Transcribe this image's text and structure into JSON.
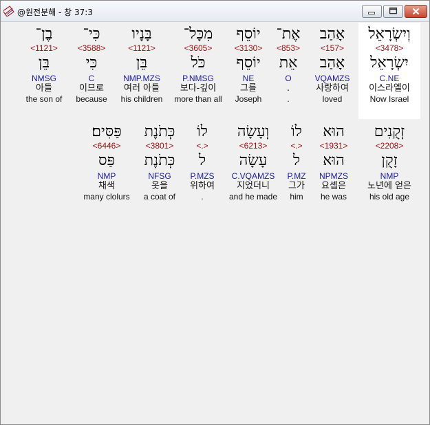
{
  "window": {
    "title": "@원전분해 - 창 37:3",
    "icon": "app-book-icon",
    "minimize_icon": "minimize-icon",
    "maximize_icon": "maximize-icon",
    "close_icon": "close-icon"
  },
  "colors": {
    "strong_number": "#a01010",
    "parsing": "#1a1aa8",
    "highlight": "#ffffff"
  },
  "verse": {
    "rows": [
      {
        "words": [
          {
            "hebrew": "וְיִשְׂרָאֵל",
            "strong": "<3478>",
            "lemma": "יִשְׂרָאֵל",
            "parsing": "C.NE",
            "korean": "이스라엘이",
            "english": "Now Israel",
            "selected": true
          },
          {
            "hebrew": "אָהַב",
            "strong": "<157>",
            "lemma": "אָהַב",
            "parsing": "VQAMZS",
            "korean": "사랑하여",
            "english": "loved"
          },
          {
            "hebrew": "אֶת־",
            "strong": "<853>",
            "lemma": "אֵת",
            "parsing": "O",
            "korean": ".",
            "english": "."
          },
          {
            "hebrew": "יוֹסֵף",
            "strong": "<3130>",
            "lemma": "יוֹסֵף",
            "parsing": "NE",
            "korean": "그를",
            "english": "Joseph"
          },
          {
            "hebrew": "מִכָּל־",
            "strong": "<3605>",
            "lemma": "כֹּל",
            "parsing": "P.NMSG",
            "korean": "보다-깊이",
            "english": "more than all"
          },
          {
            "hebrew": "בָּנָיו",
            "strong": "<1121>",
            "lemma": "בֵּן",
            "parsing": "NMP.MZS",
            "korean": "여러 아들",
            "english": "his children"
          },
          {
            "hebrew": "כִּי־",
            "strong": "<3588>",
            "lemma": "כִּי",
            "parsing": "C",
            "korean": "이므로",
            "english": "because"
          },
          {
            "hebrew": "בֶן־",
            "strong": "<1121>",
            "lemma": "בֵּן",
            "parsing": "NMSG",
            "korean": "아들",
            "english": "the son of"
          }
        ]
      },
      {
        "words": [
          {
            "hebrew": "זְקֻנִים",
            "strong": "<2208>",
            "lemma": "זָקֻן",
            "parsing": "NMP",
            "korean": "노년에 얻은",
            "english": "his old age"
          },
          {
            "hebrew": "הוּא",
            "strong": "<1931>",
            "lemma": "הוּא",
            "parsing": "NPMZS",
            "korean": "요셉은",
            "english": "he was"
          },
          {
            "hebrew": "לוֹ",
            "strong": "<.>",
            "lemma": "ל",
            "parsing": "P.MZ",
            "korean": "그가",
            "english": "him"
          },
          {
            "hebrew": "וְעָשָׂה",
            "strong": "<6213>",
            "lemma": "עָשָׂה",
            "parsing": "C.VQAMZS",
            "korean": "지었더니",
            "english": "and he made"
          },
          {
            "hebrew": "לוֹ",
            "strong": "<.>",
            "lemma": "ל",
            "parsing": "P.MZS",
            "korean": "위하여",
            "english": "."
          },
          {
            "hebrew": "כְּתֹנֶת",
            "strong": "<3801>",
            "lemma": "כְּתֹנֶת",
            "parsing": "NFSG",
            "korean": "옷을",
            "english": "a coat of"
          },
          {
            "hebrew": "פַּסִּים׃",
            "strong": "<6446>",
            "lemma": "פַּס",
            "parsing": "NMP",
            "korean": "채색",
            "english": "many clolurs"
          }
        ]
      }
    ]
  }
}
